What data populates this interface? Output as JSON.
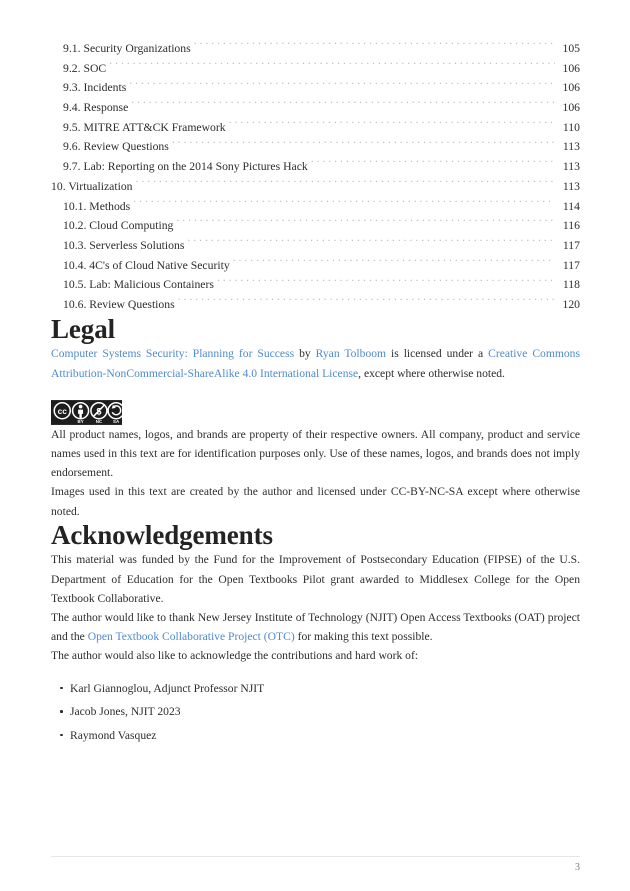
{
  "toc": {
    "entries": [
      {
        "label": "9.1. Security Organizations",
        "page": "105",
        "level": 2
      },
      {
        "label": "9.2. SOC",
        "page": "106",
        "level": 2
      },
      {
        "label": "9.3. Incidents",
        "page": "106",
        "level": 2
      },
      {
        "label": "9.4. Response",
        "page": "106",
        "level": 2
      },
      {
        "label": "9.5. MITRE ATT&CK Framework",
        "page": "110",
        "level": 2
      },
      {
        "label": "9.6. Review Questions",
        "page": "113",
        "level": 2
      },
      {
        "label": "9.7. Lab: Reporting on the 2014 Sony Pictures Hack",
        "page": "113",
        "level": 2
      },
      {
        "label": "10. Virtualization",
        "page": "113",
        "level": 1
      },
      {
        "label": "10.1. Methods",
        "page": "114",
        "level": 2
      },
      {
        "label": "10.2. Cloud Computing",
        "page": "116",
        "level": 2
      },
      {
        "label": "10.3. Serverless Solutions",
        "page": "117",
        "level": 2
      },
      {
        "label": "10.4. 4C's of Cloud Native Security",
        "page": "117",
        "level": 2
      },
      {
        "label": "10.5. Lab: Malicious Containers",
        "page": "118",
        "level": 2
      },
      {
        "label": "10.6. Review Questions",
        "page": "120",
        "level": 2
      }
    ]
  },
  "legal": {
    "heading": "Legal",
    "license_line": {
      "title_link": "Computer Systems Security: Planning for Success",
      "by_text": " by ",
      "author_link": "Ryan Tolboom",
      "mid_text": " is licensed under a ",
      "license_link": "Creative Commons Attribution-NonCommercial-ShareAlike 4.0 International License",
      "end_text": ", except where otherwise noted."
    },
    "cc_badge_alt": "CC BY-NC-SA badge",
    "cc_badge_labels": {
      "by": "BY",
      "nc": "NC",
      "sa": "SA",
      "cc": "CC"
    },
    "trademark_paragraph": "All product names, logos, and brands are property of their respective owners. All company, product and service names used in this text are for identification purposes only. Use of these names, logos, and brands does not imply endorsement.",
    "images_paragraph": "Images used in this text are created by the author and licensed under CC-BY-NC-SA except where otherwise noted."
  },
  "acknowledgements": {
    "heading": "Acknowledgements",
    "funding_paragraph": "This material was funded by the Fund for the Improvement of Postsecondary Education (FIPSE) of the U.S. Department of Education for the Open Textbooks Pilot grant awarded to Middlesex College for the Open Textbook Collaborative.",
    "thanks_paragraph": {
      "before": "The author would like to thank New Jersey Institute of Technology (NJIT) Open Access Textbooks (OAT) project and the ",
      "link": "Open Textbook Collaborative Project (OTC)",
      "after": " for making this text possible."
    },
    "contributors_intro": "The author would also like to acknowledge the contributions and hard work of:",
    "contributors": [
      "Karl Giannoglou, Adjunct Professor NJIT",
      "Jacob Jones, NJIT 2023",
      "Raymond Vasquez"
    ]
  },
  "footer": {
    "page_number": "3"
  },
  "colors": {
    "link": "#4f8ace",
    "text": "#2d2d2d",
    "heading": "#232323",
    "dots": "#b9b9b9",
    "rule": "#e6e6e6"
  }
}
